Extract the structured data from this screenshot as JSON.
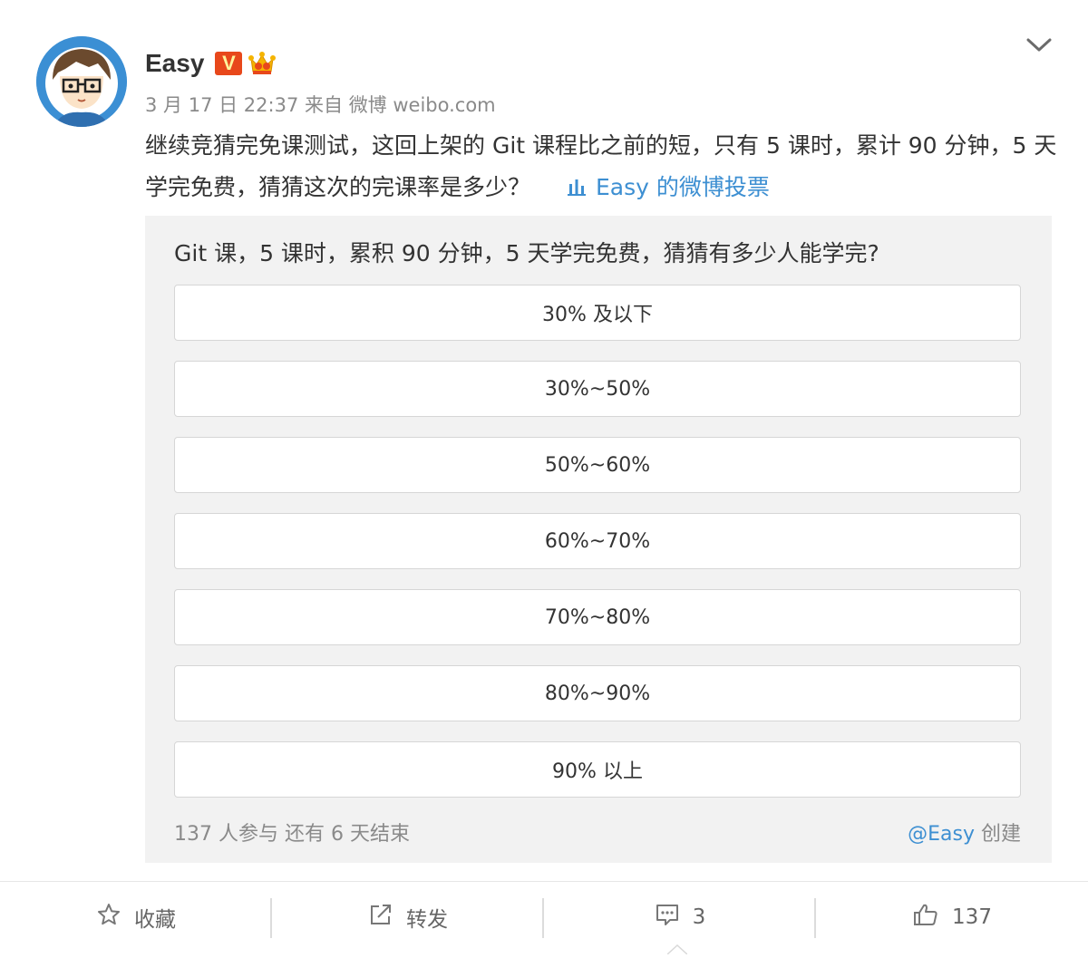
{
  "post": {
    "author": "Easy",
    "verified_badge": "V",
    "date": "3 月 17 日 22:37",
    "source_prefix": "来自",
    "source": "微博 weibo.com",
    "text": "继续竞猜完免课测试，这回上架的 Git 课程比之前的短，只有 5 课时，累计 90 分钟，5 天学完免费，猜猜这次的完课率是多少？",
    "vote_link": "Easy 的微博投票"
  },
  "poll": {
    "question": "Git 课，5 课时，累积 90 分钟，5 天学完免费，猜猜有多少人能学完?",
    "options": [
      "30% 及以下",
      "30%~50%",
      "50%~60%",
      "60%~70%",
      "70%~80%",
      "80%~90%",
      "90% 以上"
    ],
    "participants": "137 人参与",
    "remaining": "还有 6 天结束",
    "creator_at": "@Easy",
    "creator_suffix": "创建"
  },
  "actions": {
    "favorite": "收藏",
    "repost": "转发",
    "comments": "3",
    "likes": "137"
  },
  "colors": {
    "link": "#3d8fd2",
    "badge": "#e8481b",
    "poll_bg": "#f2f2f2",
    "muted": "#8a8a8a"
  },
  "icons": [
    "chevron-down-icon",
    "verified-v-icon",
    "crown-icon",
    "chart-icon",
    "star-icon",
    "share-icon",
    "comment-icon",
    "thumbs-up-icon"
  ]
}
